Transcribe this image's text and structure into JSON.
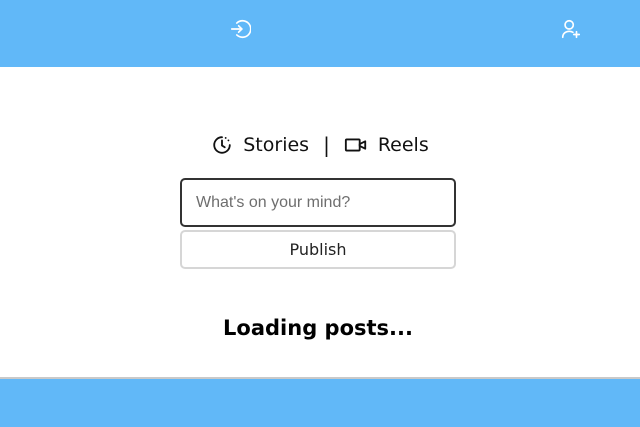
{
  "header": {
    "login_icon": "login-icon",
    "signup_icon": "user-plus-icon",
    "bar_color": "#61b8f8"
  },
  "nav": {
    "stories_label": "Stories",
    "stories_icon": "clock-icon",
    "separator": "|",
    "reels_label": "Reels",
    "reels_icon": "video-camera-icon"
  },
  "composer": {
    "placeholder": "What's on your mind?",
    "value": "",
    "publish_label": "Publish"
  },
  "feed": {
    "status_text": "Loading posts..."
  },
  "footer": {
    "bar_color": "#61b8f8"
  }
}
